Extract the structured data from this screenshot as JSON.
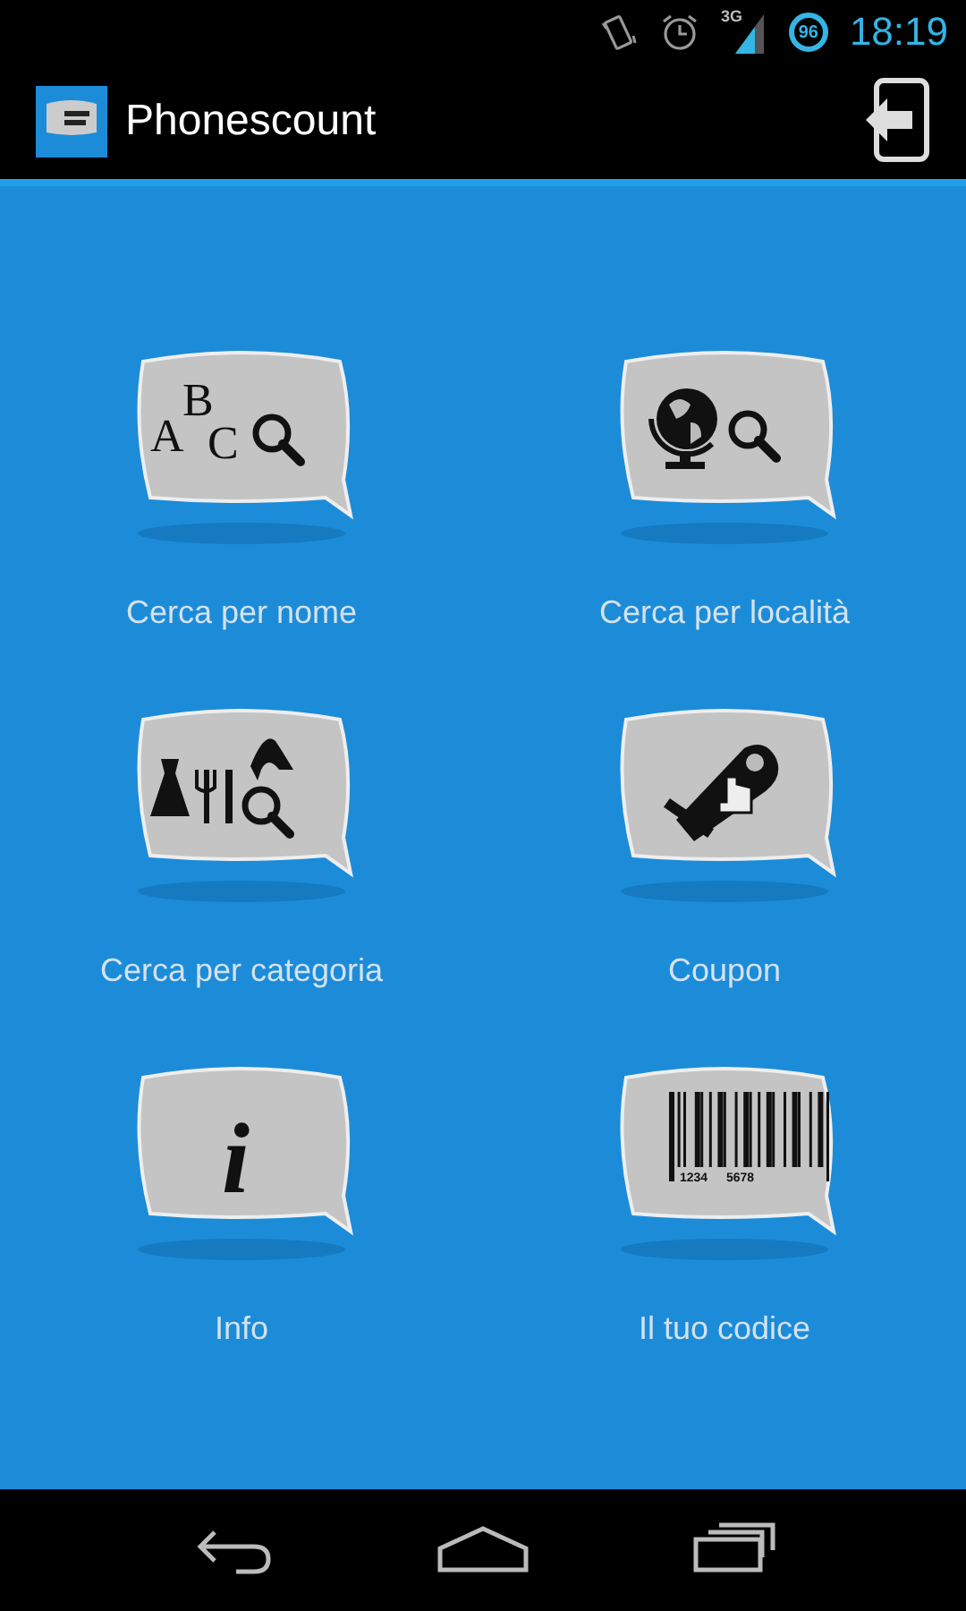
{
  "status_bar": {
    "network": "3G",
    "battery": "96",
    "time": "18:19"
  },
  "app_bar": {
    "title": "Phonescount"
  },
  "tiles": [
    {
      "kind": "abc",
      "label": "Cerca per nome",
      "icon_text": [
        "A",
        "B",
        "C"
      ]
    },
    {
      "kind": "globe",
      "label": "Cerca per località"
    },
    {
      "kind": "category",
      "label": "Cerca per categoria"
    },
    {
      "kind": "coupon",
      "label": "Coupon"
    },
    {
      "kind": "info",
      "label": "Info",
      "icon_text": [
        "i"
      ]
    },
    {
      "kind": "barcode",
      "label": "Il tuo codice",
      "icon_text": [
        "1234",
        "5678"
      ]
    }
  ]
}
